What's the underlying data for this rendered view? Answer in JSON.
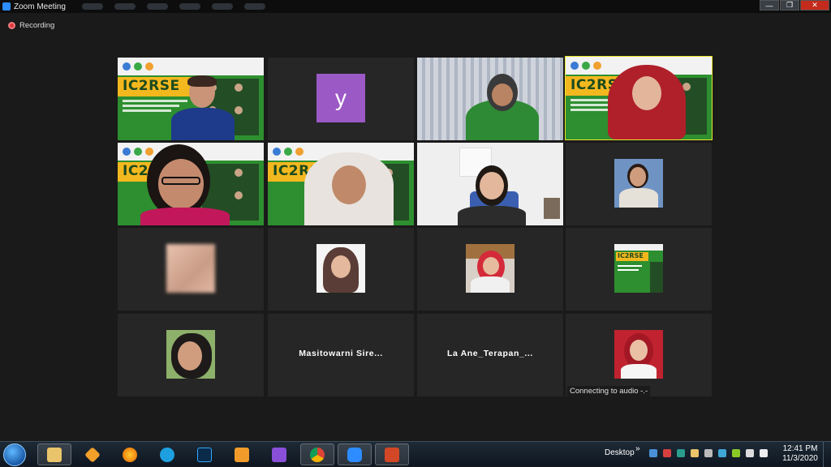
{
  "window": {
    "title": "Zoom Meeting"
  },
  "recording": {
    "label": "Recording"
  },
  "gallery": {
    "banner_title": "IC2RSE",
    "avatar_letter": "y",
    "names": [
      "Masitowarni  Sire...",
      "La  Ane_Terapan_..."
    ],
    "audio_status": "Connecting to audio -.-"
  },
  "taskbar": {
    "desktop_label": "Desktop",
    "chevron": "»",
    "time": "12:41 PM",
    "date": "11/3/2020"
  },
  "colors": {
    "active_speaker": "#e8e62a",
    "avatar_bg": "#9b59c6",
    "banner_green": "#2d8f2f",
    "banner_yellow": "#f4b81f"
  },
  "icons": [
    "zoom-icon",
    "record-icon",
    "windows-start-icon",
    "file-explorer-icon",
    "paint-icon",
    "firefox-icon",
    "internet-explorer-icon",
    "photoshop-icon",
    "media-player-icon",
    "visual-studio-icon",
    "chrome-icon",
    "zoom-taskbar-icon",
    "powerpoint-icon"
  ]
}
